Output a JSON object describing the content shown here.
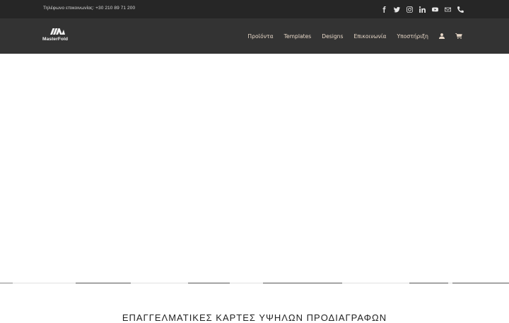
{
  "topbar": {
    "phone_text": "Τηλέφωνο επικοινωνίας: +30 210 89 71 200",
    "social_icons": [
      "facebook-icon",
      "twitter-icon",
      "instagram-icon",
      "linkedin-icon",
      "youtube-icon",
      "mail-icon",
      "phone-icon"
    ]
  },
  "header": {
    "logo_text": "MasterFold",
    "nav": [
      {
        "label": "Προϊόντα"
      },
      {
        "label": "Templates"
      },
      {
        "label": "Designs"
      },
      {
        "label": "Επικοινωνία"
      },
      {
        "label": "Υποστήριξη"
      }
    ]
  },
  "section": {
    "title": "ΕΠΑΓΓΕΛΜΑΤΙΚΕΣ ΚΑΡΤΕΣ ΥΨΗΛΩΝ ΠΡΟΔΙΑΓΡΑΦΩΝ"
  },
  "colors": {
    "topbar_bg": "#262626",
    "header_bg": "#333333",
    "nav_text": "#e8d8c8"
  }
}
